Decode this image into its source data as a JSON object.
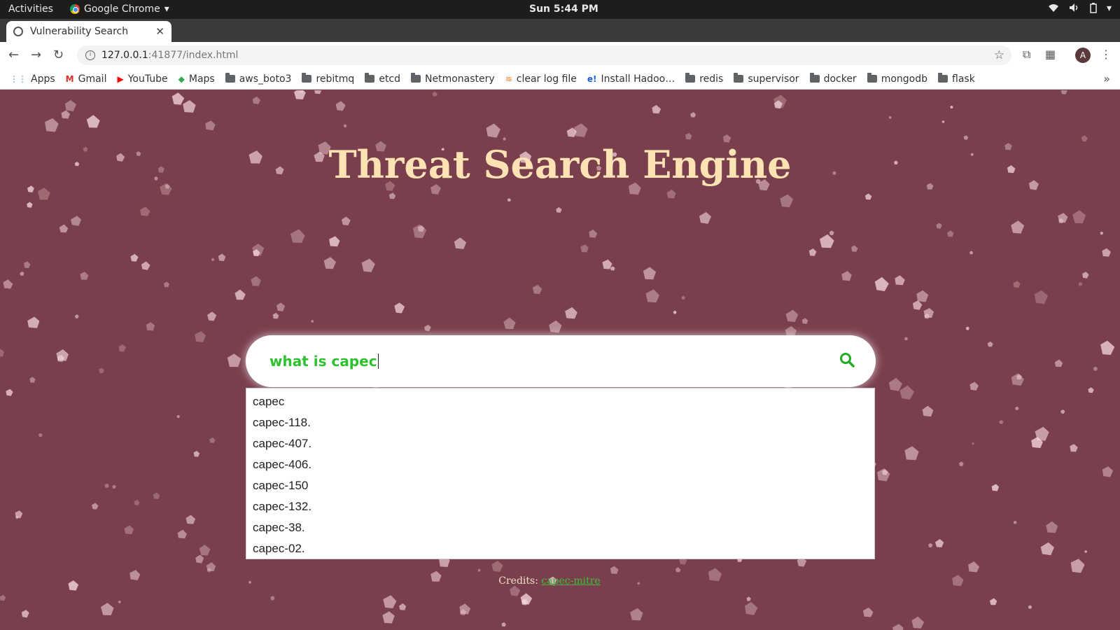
{
  "system_bar": {
    "activities": "Activities",
    "app_name": "Google Chrome",
    "clock": "Sun  5:44 PM"
  },
  "browser": {
    "tab_title": "Vulnerability Search",
    "url_host": "127.0.0.1",
    "url_rest": ":41877/index.html",
    "bookmarks": [
      {
        "label": "Apps",
        "icon": "apps-grid-icon"
      },
      {
        "label": "Gmail",
        "icon": "gmail-icon"
      },
      {
        "label": "YouTube",
        "icon": "youtube-icon"
      },
      {
        "label": "Maps",
        "icon": "maps-icon"
      },
      {
        "label": "aws_boto3",
        "icon": "folder-icon"
      },
      {
        "label": "rebitmq",
        "icon": "folder-icon"
      },
      {
        "label": "etcd",
        "icon": "folder-icon"
      },
      {
        "label": "Netmonastery",
        "icon": "folder-icon"
      },
      {
        "label": "clear log file",
        "icon": "stackoverflow-icon"
      },
      {
        "label": "Install Hadoo…",
        "icon": "edureka-icon"
      },
      {
        "label": "redis",
        "icon": "folder-icon"
      },
      {
        "label": "supervisor",
        "icon": "folder-icon"
      },
      {
        "label": "docker",
        "icon": "folder-icon"
      },
      {
        "label": "mongodb",
        "icon": "folder-icon"
      },
      {
        "label": "flask",
        "icon": "folder-icon"
      }
    ],
    "profile_initial": "A"
  },
  "page": {
    "heading": "Threat Search Engine",
    "search": {
      "query": "what is capec"
    },
    "suggestions": [
      "capec",
      "capec-118.",
      "capec-407.",
      "capec-406.",
      "capec-150",
      "capec-132.",
      "capec-38.",
      "capec-02."
    ],
    "credits_label": "Credits:",
    "credits_link": "capec-mitre"
  },
  "colors": {
    "background": "#7a3f4c",
    "heading": "#fde2b4",
    "query_text": "#2ec12e",
    "search_icon": "#22aa22",
    "credit_link": "#3dbe3d"
  }
}
